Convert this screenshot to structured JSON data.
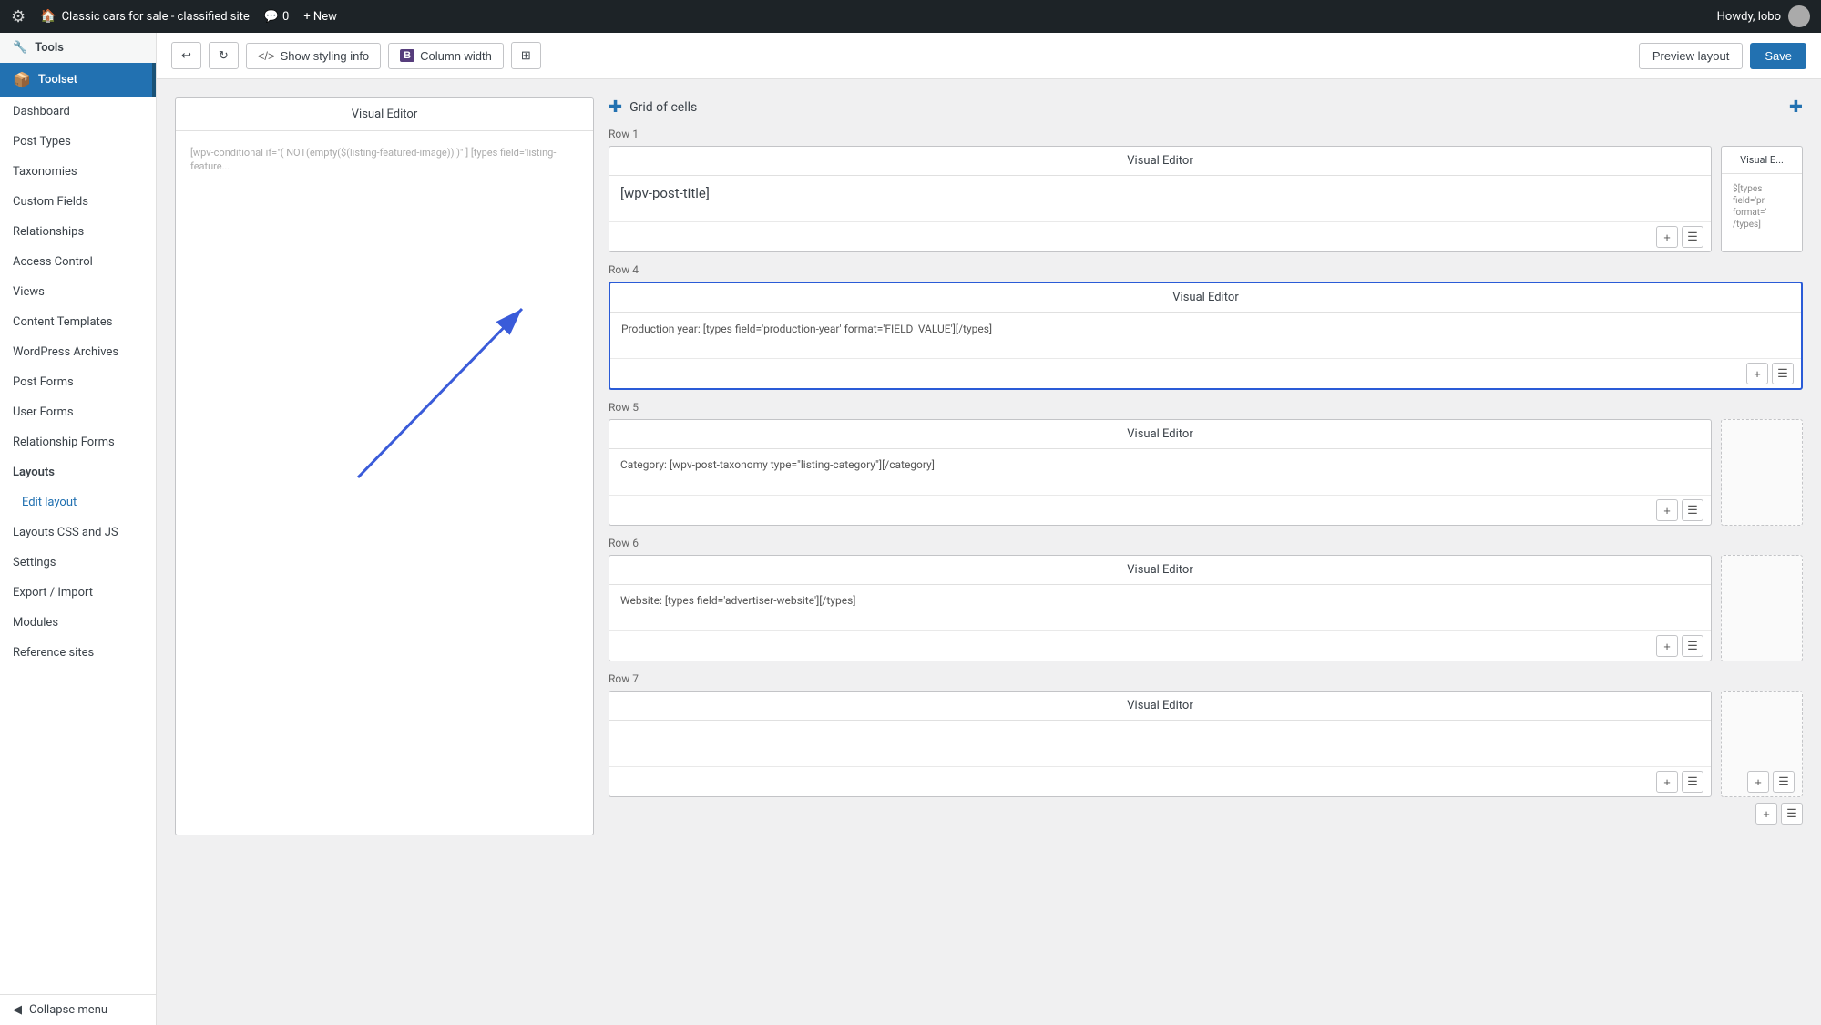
{
  "adminBar": {
    "logo": "W",
    "siteName": "Classic cars for sale - classified site",
    "commentsLabel": "Comments",
    "commentsCount": "0",
    "newLabel": "+ New",
    "greetingLabel": "Howdy, lobo"
  },
  "sidebar": {
    "toolsLabel": "Tools",
    "toolsetLabel": "Toolset",
    "items": [
      {
        "id": "dashboard",
        "label": "Dashboard"
      },
      {
        "id": "post-types",
        "label": "Post Types"
      },
      {
        "id": "taxonomies",
        "label": "Taxonomies"
      },
      {
        "id": "custom-fields",
        "label": "Custom Fields"
      },
      {
        "id": "relationships",
        "label": "Relationships"
      },
      {
        "id": "access-control",
        "label": "Access Control"
      },
      {
        "id": "views",
        "label": "Views"
      },
      {
        "id": "content-templates",
        "label": "Content Templates"
      },
      {
        "id": "wordpress-archives",
        "label": "WordPress Archives"
      },
      {
        "id": "post-forms",
        "label": "Post Forms"
      },
      {
        "id": "user-forms",
        "label": "User Forms"
      },
      {
        "id": "relationship-forms",
        "label": "Relationship Forms"
      },
      {
        "id": "layouts",
        "label": "Layouts"
      },
      {
        "id": "edit-layout",
        "label": "Edit layout"
      },
      {
        "id": "layouts-css-js",
        "label": "Layouts CSS and JS"
      },
      {
        "id": "settings",
        "label": "Settings"
      },
      {
        "id": "export-import",
        "label": "Export / Import"
      },
      {
        "id": "modules",
        "label": "Modules"
      },
      {
        "id": "reference-sites",
        "label": "Reference sites"
      }
    ],
    "collapseLabel": "Collapse menu"
  },
  "toolbar": {
    "undoLabel": "↩",
    "redoLabel": "↻",
    "stylingInfoLabel": "Show styling info",
    "columnWidthLabel": "Column width",
    "previewLayoutLabel": "Preview layout",
    "saveLabel": "Save"
  },
  "layout": {
    "gridTitle": "Grid of cells",
    "rows": [
      {
        "id": "row1",
        "label": "Row 1",
        "cells": [
          {
            "id": "r1c1",
            "type": "visual-editor",
            "header": "Visual Editor",
            "content": "[wpv-post-title]",
            "contentClass": "large",
            "highlighted": false,
            "dotted": false
          },
          {
            "id": "r1c2",
            "type": "visual-editor-small",
            "header": "Visual E...",
            "content": "$[types field='pr format=' /types]",
            "contentClass": "",
            "highlighted": false,
            "dotted": false,
            "small": true
          }
        ]
      },
      {
        "id": "row4",
        "label": "Row 4",
        "cells": [
          {
            "id": "r4c1",
            "type": "visual-editor",
            "header": "Visual Editor",
            "content": "Production year: [types field='production-year' format='FIELD_VALUE'][/types]",
            "contentClass": "",
            "highlighted": true,
            "dotted": false
          }
        ]
      },
      {
        "id": "row5",
        "label": "Row 5",
        "cells": [
          {
            "id": "r5c1",
            "type": "visual-editor",
            "header": "Visual Editor",
            "content": "Category: [wpv-post-taxonomy type=\"listing-category\"][/category]",
            "contentClass": "",
            "highlighted": false,
            "dotted": false
          },
          {
            "id": "r5c2",
            "type": "empty",
            "header": "",
            "content": "",
            "contentClass": "",
            "highlighted": false,
            "dotted": true
          }
        ]
      },
      {
        "id": "row6",
        "label": "Row 6",
        "cells": [
          {
            "id": "r6c1",
            "type": "visual-editor",
            "header": "Visual Editor",
            "content": "Website: [types field='advertiser-website'][/types]",
            "contentClass": "",
            "highlighted": false,
            "dotted": false
          },
          {
            "id": "r6c2",
            "type": "empty",
            "header": "",
            "content": "",
            "contentClass": "",
            "highlighted": false,
            "dotted": true
          }
        ]
      },
      {
        "id": "row7",
        "label": "Row 7",
        "cells": [
          {
            "id": "r7c1",
            "type": "visual-editor",
            "header": "Visual Editor",
            "content": "",
            "contentClass": "",
            "highlighted": false,
            "dotted": false
          },
          {
            "id": "r7c2",
            "type": "empty",
            "header": "",
            "content": "",
            "contentClass": "",
            "highlighted": false,
            "dotted": true
          }
        ]
      }
    ],
    "leftPanel": {
      "header": "Visual Editor",
      "content": "[wpv-conditional if=\"( NOT(empty($(listing-featured-image)) )\" ] [types field='listing-feature..."
    }
  }
}
